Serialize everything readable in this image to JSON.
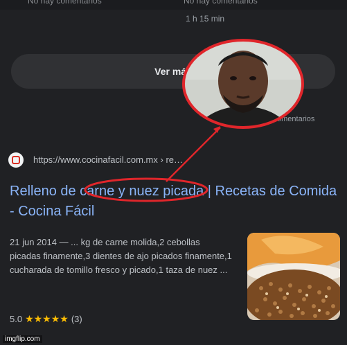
{
  "top_fragment": {
    "left": "No hay comentarios",
    "right": "No hay comentarios"
  },
  "duration": "1 h 15 min",
  "ver_mas_label": "Ver más",
  "comentarios_label": "omentarios",
  "result": {
    "url": "https://www.cocinafacil.com.mx › re…",
    "title": "Relleno de carne y nuez picada | Recetas de Comida - Cocina Fácil",
    "snippet": "21 jun 2014 — ... kg de carne molida,2 cebollas picadas finamente,3 dientes de ajo picados finamente,1 cucharada de tomillo fresco y picado,1 taza de nuez ...",
    "rating_value": "5.0",
    "stars": "★★★★★",
    "review_count": "(3)"
  },
  "watermark": "imgflip.com",
  "colors": {
    "link": "#8ab4f8",
    "annotation": "#e0262b",
    "star": "#fbbc04"
  },
  "icons": {
    "favicon": "site-favicon-icon",
    "avatar": "person-photo-circle"
  }
}
